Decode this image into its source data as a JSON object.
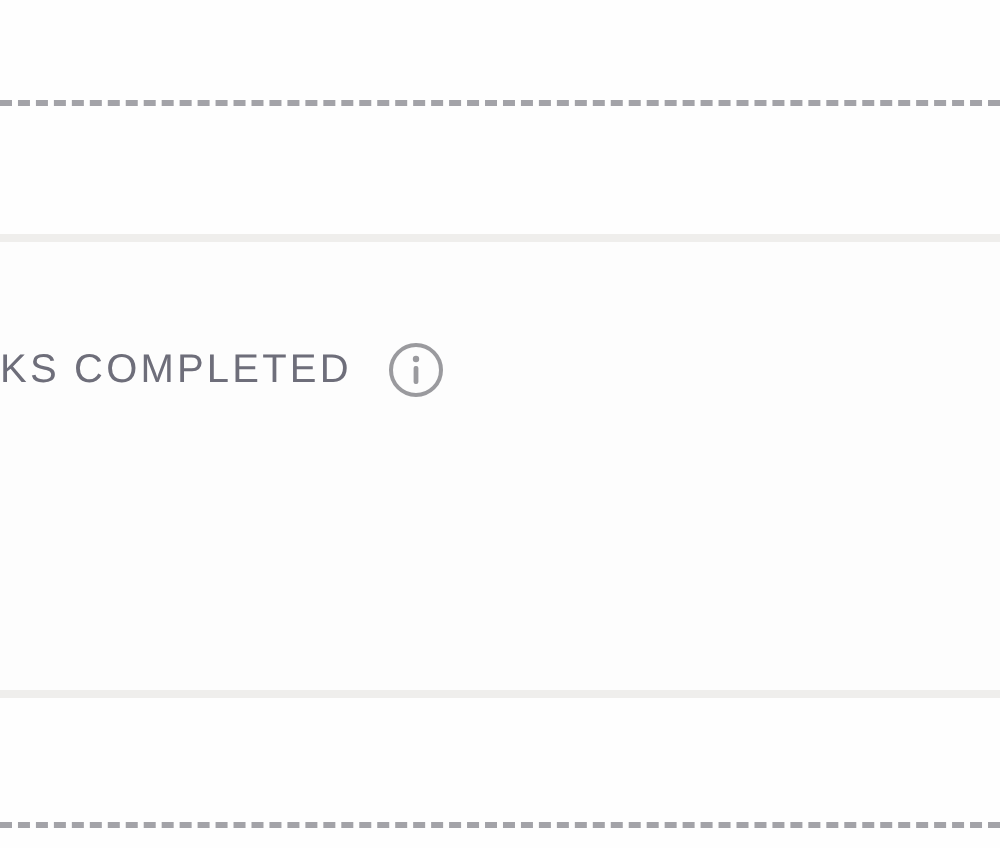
{
  "metric_card": {
    "label": "KS COMPLETED"
  }
}
